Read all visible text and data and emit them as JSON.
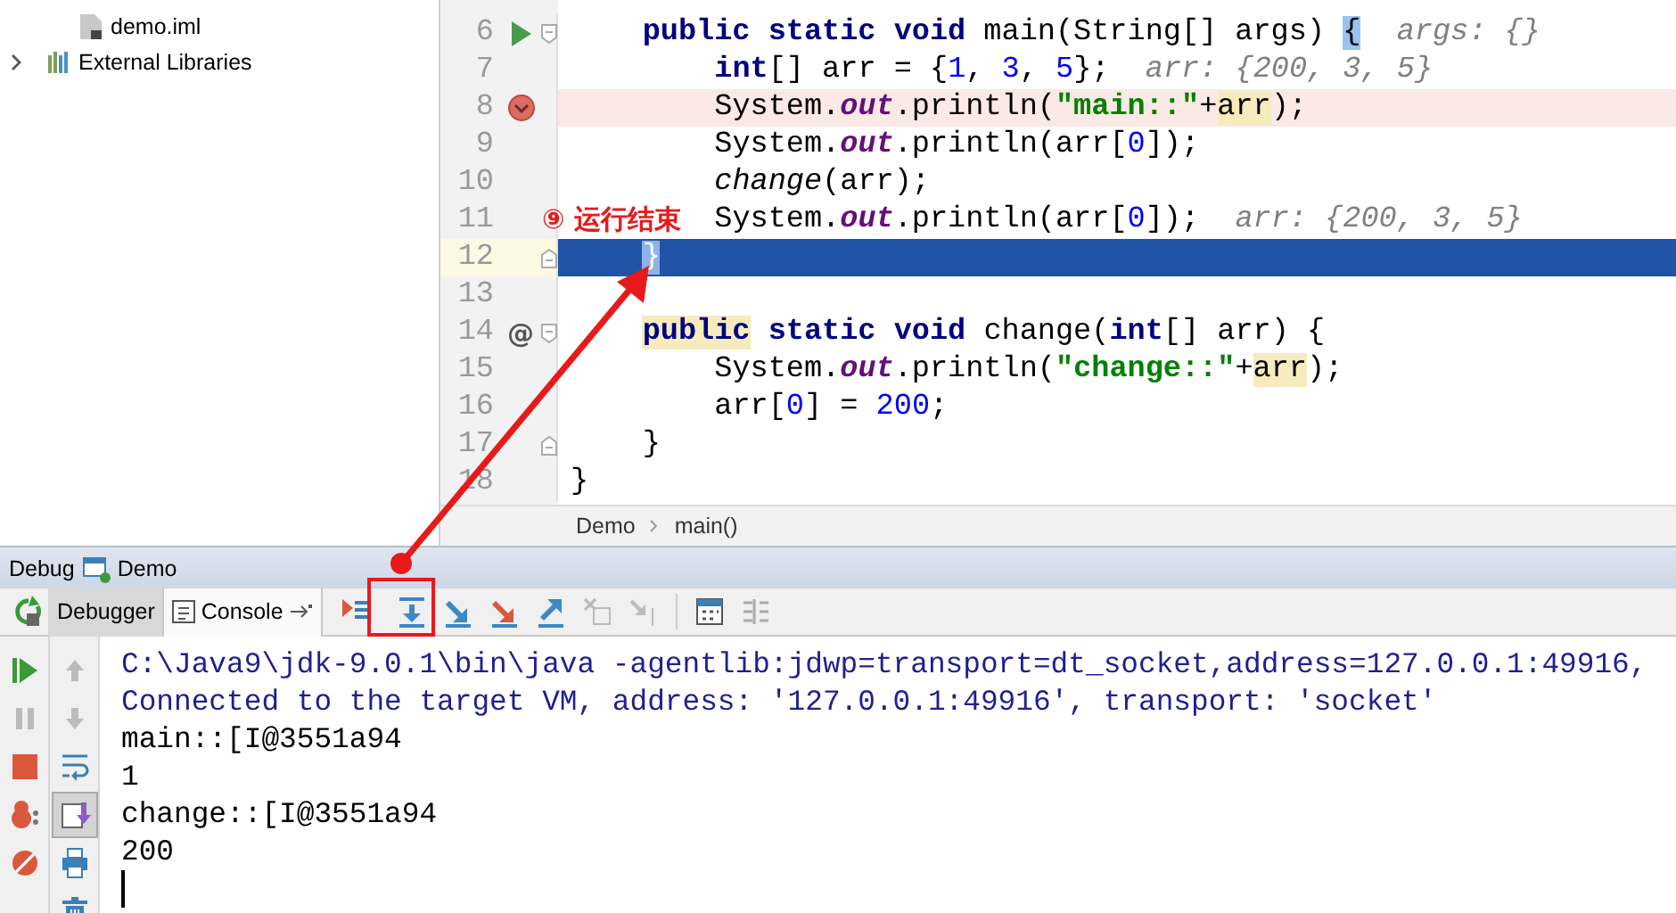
{
  "project_tree": {
    "items": [
      {
        "label": "demo.iml",
        "kind": "file"
      },
      {
        "label": "External Libraries",
        "kind": "library",
        "expanded": false
      }
    ]
  },
  "editor": {
    "lines": [
      {
        "number": "6",
        "runnable": true,
        "breakpoint": false,
        "fold_start": true,
        "fold_end": false,
        "current": false,
        "tokens": [
          {
            "text": "    public ",
            "kind": "keyword"
          },
          {
            "text": "static ",
            "kind": "keyword"
          },
          {
            "text": "void",
            "kind": "keyword"
          },
          {
            "text": " main(String[] args) ",
            "kind": "plain"
          },
          {
            "text": "{",
            "kind": "brace_match"
          },
          {
            "text": "  args: {}",
            "kind": "hint"
          }
        ]
      },
      {
        "number": "7",
        "runnable": false,
        "breakpoint": false,
        "fold_start": false,
        "fold_end": false,
        "current": false,
        "tokens": [
          {
            "text": "        int",
            "kind": "keyword"
          },
          {
            "text": "[] arr = {",
            "kind": "plain"
          },
          {
            "text": "1",
            "kind": "number"
          },
          {
            "text": ", ",
            "kind": "plain"
          },
          {
            "text": "3",
            "kind": "number"
          },
          {
            "text": ", ",
            "kind": "plain"
          },
          {
            "text": "5",
            "kind": "number"
          },
          {
            "text": "};",
            "kind": "plain"
          },
          {
            "text": "  arr: {200, 3, 5}",
            "kind": "hint"
          }
        ]
      },
      {
        "number": "8",
        "runnable": false,
        "breakpoint": true,
        "fold_start": false,
        "fold_end": false,
        "current": false,
        "tokens": [
          {
            "text": "        System.",
            "kind": "plain"
          },
          {
            "text": "out",
            "kind": "field"
          },
          {
            "text": ".println(",
            "kind": "plain"
          },
          {
            "text": "\"main::\"",
            "kind": "string"
          },
          {
            "text": "+",
            "kind": "plain"
          },
          {
            "text": "arr",
            "kind": "usage"
          },
          {
            "text": ");",
            "kind": "plain"
          }
        ]
      },
      {
        "number": "9",
        "runnable": false,
        "breakpoint": false,
        "fold_start": false,
        "fold_end": false,
        "current": false,
        "tokens": [
          {
            "text": "        System.",
            "kind": "plain"
          },
          {
            "text": "out",
            "kind": "field"
          },
          {
            "text": ".println(arr[",
            "kind": "plain"
          },
          {
            "text": "0",
            "kind": "number"
          },
          {
            "text": "]);",
            "kind": "plain"
          }
        ]
      },
      {
        "number": "10",
        "runnable": false,
        "breakpoint": false,
        "fold_start": false,
        "fold_end": false,
        "current": false,
        "tokens": [
          {
            "text": "        change",
            "kind": "call"
          },
          {
            "text": "(arr);",
            "kind": "plain"
          }
        ]
      },
      {
        "number": "11",
        "runnable": false,
        "breakpoint": false,
        "fold_start": false,
        "fold_end": false,
        "current": false,
        "tokens": [
          {
            "text": "        System.",
            "kind": "plain"
          },
          {
            "text": "out",
            "kind": "field"
          },
          {
            "text": ".println(arr[",
            "kind": "plain"
          },
          {
            "text": "0",
            "kind": "number"
          },
          {
            "text": "]);",
            "kind": "plain"
          },
          {
            "text": "  arr: {200, 3, 5}",
            "kind": "hint"
          }
        ]
      },
      {
        "number": "12",
        "runnable": false,
        "breakpoint": false,
        "fold_start": false,
        "fold_end": true,
        "current": true,
        "tokens": [
          {
            "text": "    }",
            "kind": "brace_match"
          }
        ]
      },
      {
        "number": "13",
        "runnable": false,
        "breakpoint": false,
        "fold_start": false,
        "fold_end": false,
        "current": false
      },
      {
        "number": "14",
        "gutter_mark": "@",
        "runnable": false,
        "breakpoint": false,
        "fold_start": true,
        "fold_end": false,
        "current": false,
        "tokens": [
          {
            "text": "    public",
            "kind": "keyword_usage"
          },
          {
            "text": " static ",
            "kind": "keyword"
          },
          {
            "text": "void",
            "kind": "keyword"
          },
          {
            "text": " change(",
            "kind": "plain"
          },
          {
            "text": "int",
            "kind": "keyword"
          },
          {
            "text": "[] arr) {",
            "kind": "plain"
          }
        ]
      },
      {
        "number": "15",
        "runnable": false,
        "breakpoint": false,
        "fold_start": false,
        "fold_end": false,
        "current": false,
        "tokens": [
          {
            "text": "        System.",
            "kind": "plain"
          },
          {
            "text": "out",
            "kind": "field"
          },
          {
            "text": ".println(",
            "kind": "plain"
          },
          {
            "text": "\"change::\"",
            "kind": "string"
          },
          {
            "text": "+",
            "kind": "plain"
          },
          {
            "text": "arr",
            "kind": "usage"
          },
          {
            "text": ");",
            "kind": "plain"
          }
        ]
      },
      {
        "number": "16",
        "runnable": false,
        "breakpoint": false,
        "fold_start": false,
        "fold_end": false,
        "current": false,
        "tokens": [
          {
            "text": "        arr[",
            "kind": "plain"
          },
          {
            "text": "0",
            "kind": "number"
          },
          {
            "text": "] = ",
            "kind": "plain"
          },
          {
            "text": "200",
            "kind": "number"
          },
          {
            "text": ";",
            "kind": "plain"
          }
        ]
      },
      {
        "number": "17",
        "runnable": false,
        "breakpoint": false,
        "fold_start": false,
        "fold_end": true,
        "current": false,
        "tokens": [
          {
            "text": "    }",
            "kind": "plain"
          }
        ]
      },
      {
        "number": "18",
        "runnable": false,
        "breakpoint": false,
        "fold_start": false,
        "fold_end": false,
        "current": false,
        "tokens": [
          {
            "text": "}",
            "kind": "plain"
          }
        ]
      }
    ],
    "breadcrumbs": [
      "Demo",
      "main()"
    ]
  },
  "annotation": {
    "label": "⑨ 运行结束"
  },
  "debug": {
    "title": "Debug",
    "config": "Demo",
    "tabs": [
      {
        "label": "Debugger",
        "selected": false
      },
      {
        "label": "Console",
        "selected": true
      }
    ],
    "scroll_to_end": {
      "on": true
    },
    "console": [
      {
        "text": "C:\\Java9\\jdk-9.0.1\\bin\\java -agentlib:jdwp=transport=dt_socket,address=127.0.0.1:49916,",
        "kind": "system"
      },
      {
        "text": "Connected to the target VM, address: '127.0.0.1:49916', transport: 'socket'",
        "kind": "system"
      },
      {
        "text": "main::[I@3551a94",
        "kind": "output"
      },
      {
        "text": "1",
        "kind": "output"
      },
      {
        "text": "change::[I@3551a94",
        "kind": "output"
      },
      {
        "text": "200",
        "kind": "output"
      }
    ]
  }
}
